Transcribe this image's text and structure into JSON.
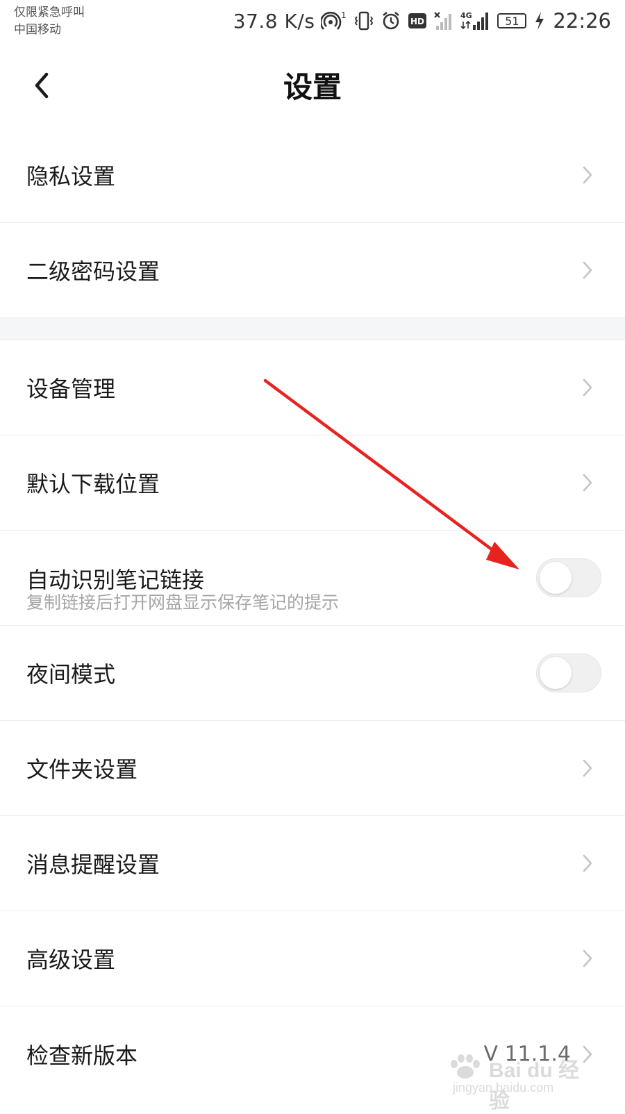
{
  "status_bar": {
    "carrier_line1": "仅限紧急呼叫",
    "carrier_line2": "中国移动",
    "net_speed": "37.8 K/s",
    "hotspot_count": "1",
    "hd_badge": "HD",
    "network_type": "4G",
    "battery_level": "51",
    "time": "22:26",
    "icons": [
      "hotspot-icon",
      "vibrate-icon",
      "alarm-icon",
      "hd-icon",
      "no-signal-icon",
      "signal-4g-icon",
      "battery-icon",
      "charging-icon"
    ]
  },
  "header": {
    "title": "设置",
    "back_icon": "chevron-left-icon"
  },
  "settings": {
    "privacy": {
      "label": "隐私设置"
    },
    "second_password": {
      "label": "二级密码设置"
    },
    "device_management": {
      "label": "设备管理"
    },
    "default_download": {
      "label": "默认下载位置"
    },
    "auto_note_link": {
      "label": "自动识别笔记链接",
      "description": "复制链接后打开网盘显示保存笔记的提示",
      "enabled": false
    },
    "night_mode": {
      "label": "夜间模式",
      "enabled": false
    },
    "folder_settings": {
      "label": "文件夹设置"
    },
    "message_reminder": {
      "label": "消息提醒设置"
    },
    "advanced": {
      "label": "高级设置"
    },
    "check_version": {
      "label": "检查新版本",
      "value": "V 11.1.4"
    }
  },
  "watermark": {
    "brand": "Bai du 经验",
    "domain": "jingyan.baidu.com"
  },
  "colors": {
    "annotation_arrow": "#e8231f",
    "toggle_off_track": "#f0f0f0",
    "section_gap": "#f5f6f8",
    "divider": "#ececec"
  }
}
